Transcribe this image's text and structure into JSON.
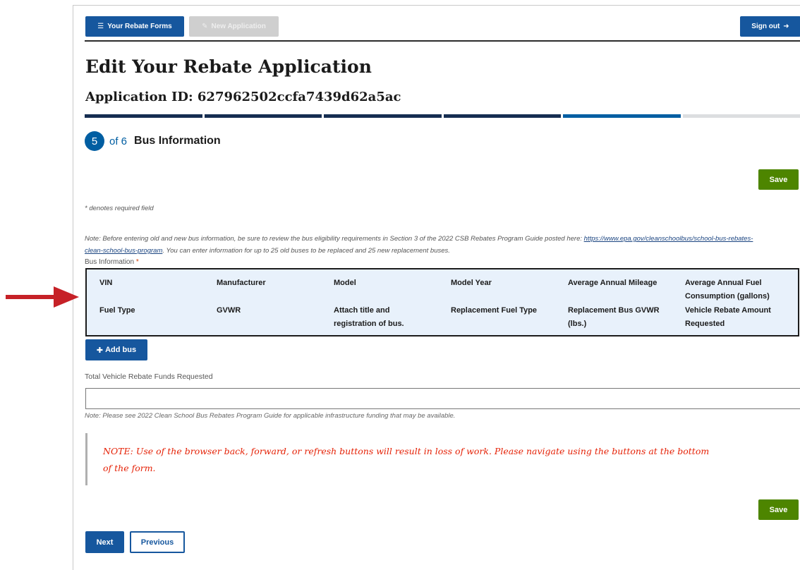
{
  "nav": {
    "your_rebate_forms": "Your Rebate Forms",
    "new_application": "New Application",
    "sign_out": "Sign out"
  },
  "page": {
    "title": "Edit Your Rebate Application",
    "application_id": "Application ID: 627962502ccfa7439d62a5ac"
  },
  "stepper": {
    "current": "5",
    "of": "of 6",
    "label": "Bus Information"
  },
  "save_label": "Save",
  "required_note": "* denotes required field",
  "bus_note": {
    "before": "Note: Before entering old and new bus information, be sure to review the bus eligibility requirements in Section 3 of the 2022 CSB Rebates Program Guide posted here:",
    "link": "https://www.epa.gov/cleanschoolbus/school-bus-rebates-clean-school-bus-program",
    "after": ". You can enter information for up to 25 old buses to be replaced and 25 new replacement buses."
  },
  "bus_table": {
    "label": "Bus Information",
    "required_mark": "*",
    "row1": [
      "VIN",
      "Manufacturer",
      "Model",
      "Model Year",
      "Average Annual Mileage",
      "Average Annual Fuel Consumption (gallons)"
    ],
    "row2": [
      "Fuel Type",
      "GVWR",
      "Attach title and registration of bus.",
      "Replacement Fuel Type",
      "Replacement Bus GVWR (lbs.)",
      "Vehicle Rebate Amount Requested"
    ]
  },
  "add_bus_label": "Add bus",
  "total": {
    "label": "Total Vehicle Rebate Funds Requested",
    "value": ""
  },
  "infra_note": "Note: Please see 2022 Clean School Bus Rebates Program Guide for applicable infrastructure funding that may be available.",
  "warning": "NOTE: Use of the browser back, forward, or refresh buttons will result in loss of work. Please navigate using the buttons at the bottom of the form.",
  "footer": {
    "next": "Next",
    "previous": "Previous"
  },
  "colors": {
    "primary": "#16579e",
    "save_green": "#4d8500",
    "step_done": "#162e51",
    "warning_red": "#e52207",
    "annotation_arrow": "#c62127"
  },
  "icons": {
    "menu": "menu-icon",
    "new_app": "new-document-icon",
    "sign_out": "logout-icon",
    "add": "plus-icon",
    "annotation": "red-arrow-icon"
  }
}
